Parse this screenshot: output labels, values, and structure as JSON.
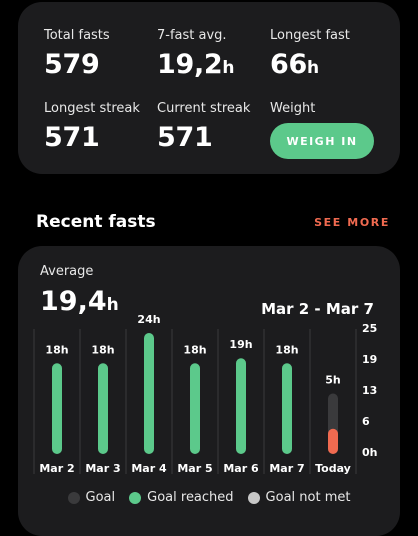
{
  "stats": {
    "total_fasts_label": "Total fasts",
    "total_fasts_value": "579",
    "avg_label": "7-fast avg.",
    "avg_value": "19,2",
    "avg_unit": "h",
    "longest_fast_label": "Longest fast",
    "longest_fast_value": "66",
    "longest_fast_unit": "h",
    "longest_streak_label": "Longest streak",
    "longest_streak_value": "571",
    "current_streak_label": "Current streak",
    "current_streak_value": "571",
    "weight_label": "Weight",
    "weigh_in_button": "WEIGH IN"
  },
  "recent": {
    "title": "Recent fasts",
    "see_more": "SEE MORE",
    "average_label": "Average",
    "average_value": "19,4",
    "average_unit": "h",
    "date_range": "Mar 2 - Mar 7"
  },
  "legend": {
    "goal": "Goal",
    "goal_reached": "Goal reached",
    "goal_not_met": "Goal not met"
  },
  "colors": {
    "goal": "#3a3a3c",
    "goal_reached": "#5cc98b",
    "goal_not_met": "#c7c7c7",
    "in_progress": "#f06a50",
    "accent": "#f06a50"
  },
  "chart_data": {
    "type": "bar",
    "categories": [
      "Mar 2",
      "Mar 3",
      "Mar 4",
      "Mar 5",
      "Mar 6",
      "Mar 7",
      "Today"
    ],
    "values": [
      18,
      18,
      24,
      18,
      19,
      18,
      5
    ],
    "value_labels": [
      "18h",
      "18h",
      "24h",
      "18h",
      "19h",
      "18h",
      "5h"
    ],
    "status": [
      "reached",
      "reached",
      "reached",
      "reached",
      "reached",
      "reached",
      "in_progress"
    ],
    "goal": 16,
    "y_ticks": [
      "25",
      "19",
      "13",
      "6",
      "0h"
    ],
    "ylim": [
      0,
      25
    ]
  }
}
